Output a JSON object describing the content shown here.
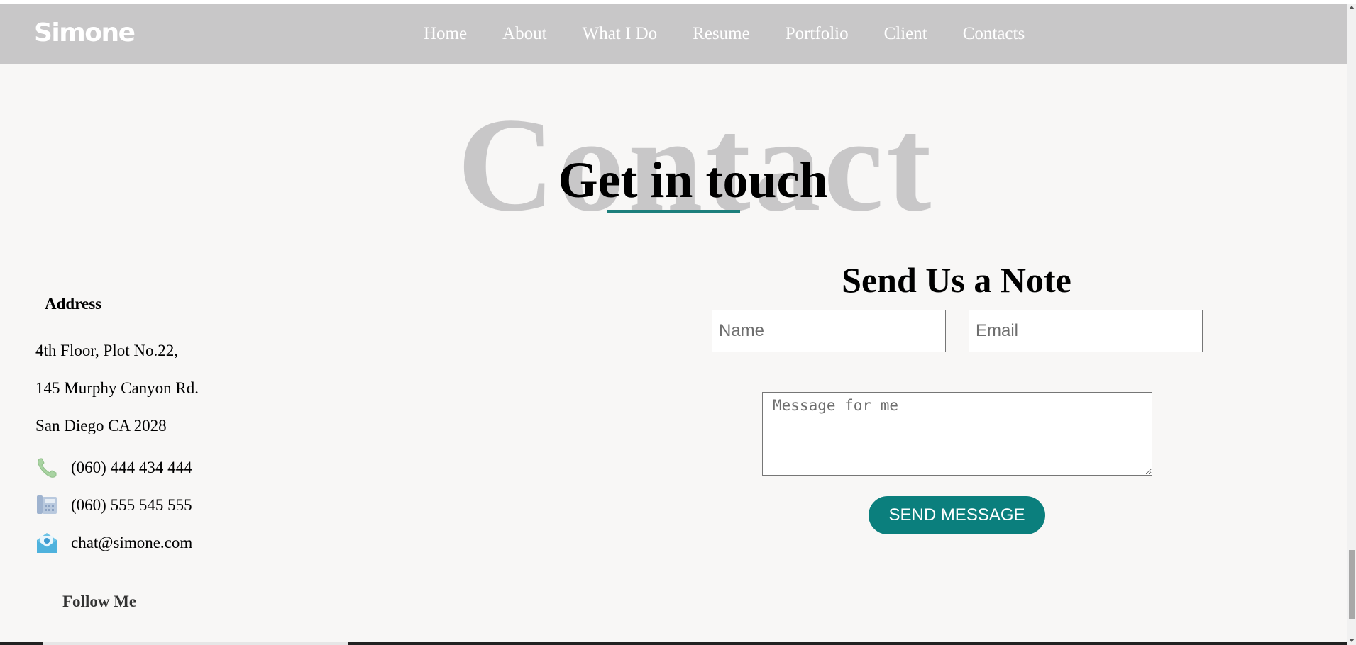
{
  "brand": {
    "name": "Simone"
  },
  "nav": {
    "items": [
      {
        "label": "Home"
      },
      {
        "label": "About"
      },
      {
        "label": "What I Do"
      },
      {
        "label": "Resume"
      },
      {
        "label": "Portfolio"
      },
      {
        "label": "Client"
      },
      {
        "label": "Contacts"
      }
    ]
  },
  "hero": {
    "background_word": "Contact",
    "heading": "Get in touch",
    "accent_color": "#1d7f7c"
  },
  "address": {
    "label": "Address",
    "lines": [
      "4th Floor, Plot No.22,",
      "145 Murphy Canyon Rd.",
      "San Diego CA 2028"
    ],
    "phone": {
      "icon": "phone-icon",
      "text": "(060) 444 434 444"
    },
    "fax": {
      "icon": "fax-icon",
      "text": "(060) 555 545 555"
    },
    "email": {
      "icon": "mail-icon",
      "text": "chat@simone.com"
    },
    "follow_label": "Follow Me"
  },
  "form": {
    "heading": "Send Us a Note",
    "name_placeholder": "Name",
    "email_placeholder": "Email",
    "message_placeholder": "Message for me",
    "submit_label": "SEND MESSAGE",
    "button_color": "#0b7f7d"
  }
}
